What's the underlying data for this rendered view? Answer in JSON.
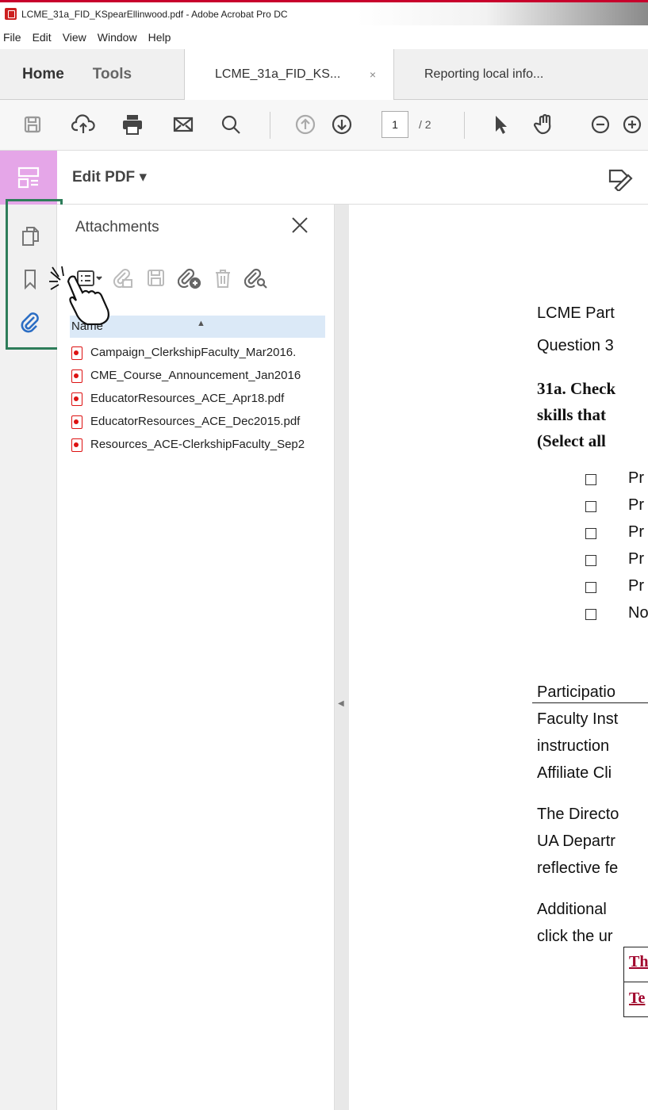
{
  "window": {
    "title": "LCME_31a_FID_KSpearEllinwood.pdf - Adobe Acrobat Pro DC"
  },
  "menu": [
    "File",
    "Edit",
    "View",
    "Window",
    "Help"
  ],
  "tabs": {
    "home": "Home",
    "tools": "Tools",
    "documents": [
      {
        "label": "LCME_31a_FID_KS...",
        "close": "×"
      },
      {
        "label": "Reporting local info..."
      }
    ]
  },
  "toolbar": {
    "page_current": "1",
    "page_total": "/ 2"
  },
  "editbar": {
    "label": "Edit PDF ▾"
  },
  "attachments_panel": {
    "title": "Attachments",
    "column_header": "Name",
    "files": [
      "Campaign_ClerkshipFaculty_Mar2016.",
      "CME_Course_Announcement_Jan2016",
      "EducatorResources_ACE_Apr18.pdf",
      "EducatorResources_ACE_Dec2015.pdf",
      "Resources_ACE-ClerkshipFaculty_Sep2"
    ]
  },
  "document": {
    "line1": "LCME Part",
    "line2": "Question 3",
    "heading": [
      "31a. Check",
      "skills that",
      "(Select all"
    ],
    "options": [
      "Pr",
      "Pr",
      "Pr",
      "Pr",
      "Pr",
      "No"
    ],
    "para1": [
      "Participatio",
      "Faculty Inst",
      "instruction",
      "Affiliate Cli"
    ],
    "para2": [
      "The Directo",
      "UA Departr",
      "reflective fe"
    ],
    "para3": [
      "Additional",
      "click the ur"
    ],
    "links": [
      "Th",
      "Te"
    ]
  }
}
